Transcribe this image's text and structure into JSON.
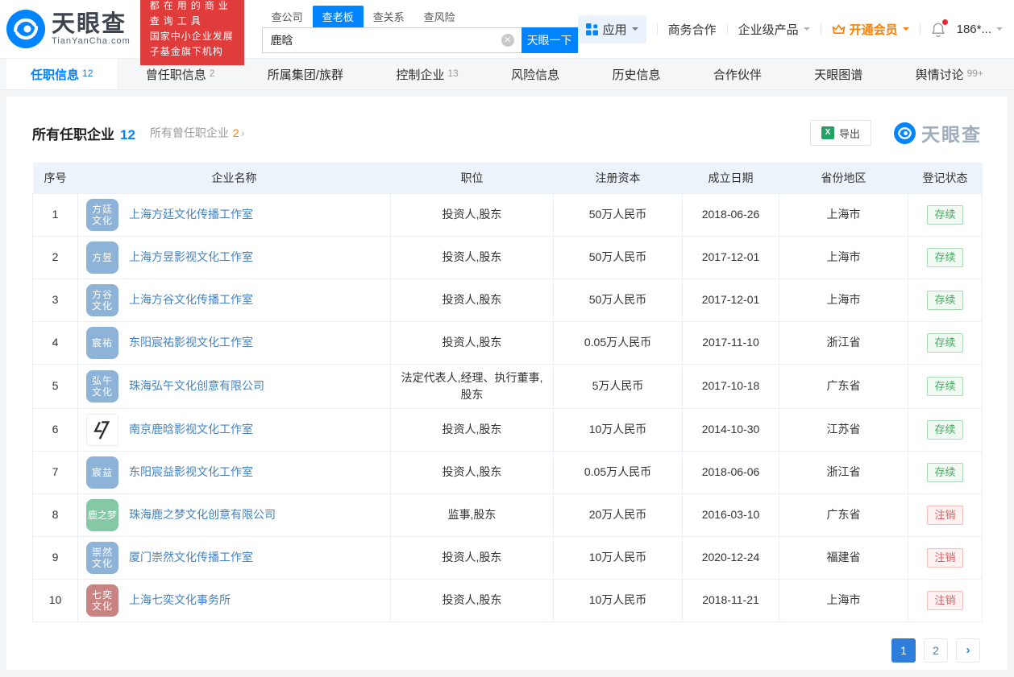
{
  "brand": {
    "name_cn": "天眼查",
    "name_en": "TianYanCha.com",
    "slogan_line1": "都在用的商业查询工具",
    "slogan_line2": "国家中小企业发展子基金旗下机构",
    "accent_color": "#0084ff"
  },
  "header": {
    "search": {
      "tabs": [
        {
          "label": "查公司",
          "active": false
        },
        {
          "label": "查老板",
          "active": true
        },
        {
          "label": "查关系",
          "active": false
        },
        {
          "label": "查风险",
          "active": false
        }
      ],
      "value": "鹿晗",
      "button": "天眼一下"
    },
    "menu": {
      "apps": "应用",
      "cooperation": "商务合作",
      "enterprise": "企业级产品",
      "vip": "开通会员",
      "phone": "186*..."
    }
  },
  "nav": {
    "tabs": [
      {
        "label": "任职信息",
        "count": "12",
        "active": true
      },
      {
        "label": "曾任职信息",
        "count": "2",
        "active": false
      },
      {
        "label": "所属集团/族群",
        "count": "",
        "active": false
      },
      {
        "label": "控制企业",
        "count": "13",
        "active": false
      },
      {
        "label": "风险信息",
        "count": "",
        "active": false
      },
      {
        "label": "历史信息",
        "count": "",
        "active": false
      },
      {
        "label": "合作伙伴",
        "count": "",
        "active": false
      },
      {
        "label": "天眼图谱",
        "count": "",
        "active": false
      },
      {
        "label": "舆情讨论",
        "count": "99+",
        "active": false
      }
    ]
  },
  "section": {
    "title": "所有任职企业",
    "title_count": "12",
    "subtitle": "所有曾任职企业",
    "subtitle_count": "2",
    "subtitle_arrow": "›",
    "export_label": "导出",
    "watermark": "天眼查"
  },
  "table": {
    "columns": [
      "序号",
      "企业名称",
      "职位",
      "注册资本",
      "成立日期",
      "省份地区",
      "登记状态"
    ],
    "status_colors": {
      "active": "#48a95f",
      "cancelled": "#e25b5b"
    },
    "rows": [
      {
        "no": "1",
        "icon_lines": [
          "方廷",
          "文化"
        ],
        "icon_color": "#8db4d8",
        "logo": false,
        "name": "上海方廷文化传播工作室",
        "position": "投资人,股东",
        "capital": "50万人民币",
        "date": "2018-06-26",
        "province": "上海市",
        "status": "存续",
        "status_type": "active"
      },
      {
        "no": "2",
        "icon_lines": [
          "方昱"
        ],
        "icon_color": "#8db4d8",
        "logo": false,
        "name": "上海方昱影视文化工作室",
        "position": "投资人,股东",
        "capital": "50万人民币",
        "date": "2017-12-01",
        "province": "上海市",
        "status": "存续",
        "status_type": "active"
      },
      {
        "no": "3",
        "icon_lines": [
          "方谷",
          "文化"
        ],
        "icon_color": "#8db4d8",
        "logo": false,
        "name": "上海方谷文化传播工作室",
        "position": "投资人,股东",
        "capital": "50万人民币",
        "date": "2017-12-01",
        "province": "上海市",
        "status": "存续",
        "status_type": "active"
      },
      {
        "no": "4",
        "icon_lines": [
          "宸祐"
        ],
        "icon_color": "#8db4d8",
        "logo": false,
        "name": "东阳宸祐影视文化工作室",
        "position": "投资人,股东",
        "capital": "0.05万人民币",
        "date": "2017-11-10",
        "province": "浙江省",
        "status": "存续",
        "status_type": "active"
      },
      {
        "no": "5",
        "icon_lines": [
          "弘午",
          "文化"
        ],
        "icon_color": "#8db4d8",
        "logo": false,
        "name": "珠海弘午文化创意有限公司",
        "position": "法定代表人,经理、执行董事,股东",
        "capital": "5万人民币",
        "date": "2017-10-18",
        "province": "广东省",
        "status": "存续",
        "status_type": "active"
      },
      {
        "no": "6",
        "icon_lines": [],
        "icon_color": "#ffffff",
        "logo": true,
        "name": "南京鹿晗影视文化工作室",
        "position": "投资人,股东",
        "capital": "10万人民币",
        "date": "2014-10-30",
        "province": "江苏省",
        "status": "存续",
        "status_type": "active"
      },
      {
        "no": "7",
        "icon_lines": [
          "宸益"
        ],
        "icon_color": "#8db4d8",
        "logo": false,
        "name": "东阳宸益影视文化工作室",
        "position": "投资人,股东",
        "capital": "0.05万人民币",
        "date": "2018-06-06",
        "province": "浙江省",
        "status": "存续",
        "status_type": "active"
      },
      {
        "no": "8",
        "icon_lines": [
          "鹿之梦"
        ],
        "icon_color": "#85c9a4",
        "logo": false,
        "name": "珠海鹿之梦文化创意有限公司",
        "position": "监事,股东",
        "capital": "20万人民币",
        "date": "2016-03-10",
        "province": "广东省",
        "status": "注销",
        "status_type": "cancelled"
      },
      {
        "no": "9",
        "icon_lines": [
          "崇然",
          "文化"
        ],
        "icon_color": "#8db4d8",
        "logo": false,
        "name": "厦门崇然文化传播工作室",
        "position": "投资人,股东",
        "capital": "10万人民币",
        "date": "2020-12-24",
        "province": "福建省",
        "status": "注销",
        "status_type": "cancelled"
      },
      {
        "no": "10",
        "icon_lines": [
          "七奕",
          "文化"
        ],
        "icon_color": "#c98383",
        "logo": false,
        "name": "上海七奕文化事务所",
        "position": "投资人,股东",
        "capital": "10万人民币",
        "date": "2018-11-21",
        "province": "上海市",
        "status": "注销",
        "status_type": "cancelled"
      }
    ]
  },
  "pagination": {
    "pages": [
      "1",
      "2"
    ],
    "current": "1",
    "next": "›"
  }
}
